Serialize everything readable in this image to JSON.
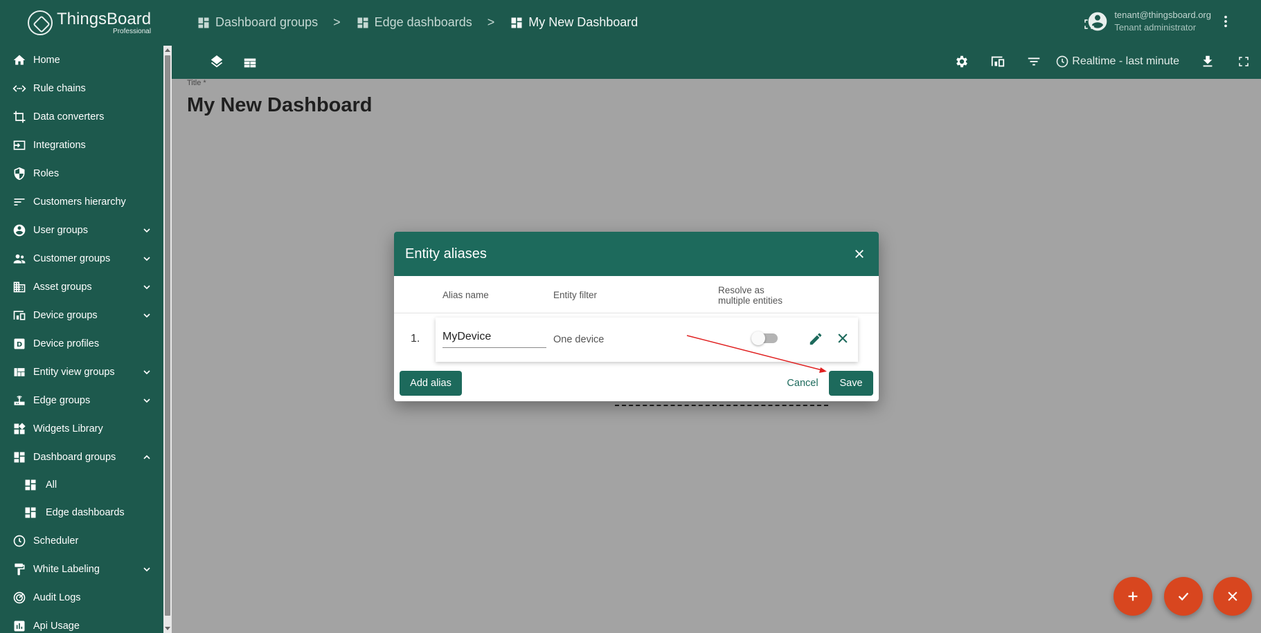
{
  "app": {
    "logo_name": "ThingsBoard",
    "logo_sub": "Professional"
  },
  "sidebar": {
    "items": [
      {
        "label": "Home",
        "icon": "home-icon"
      },
      {
        "label": "Rule chains",
        "icon": "rule-chains-icon"
      },
      {
        "label": "Data converters",
        "icon": "data-converters-icon"
      },
      {
        "label": "Integrations",
        "icon": "integrations-icon"
      },
      {
        "label": "Roles",
        "icon": "shield-icon"
      },
      {
        "label": "Customers hierarchy",
        "icon": "sort-icon"
      },
      {
        "label": "User groups",
        "icon": "account-circle-icon",
        "expandable": true
      },
      {
        "label": "Customer groups",
        "icon": "supervisor-icon",
        "expandable": true
      },
      {
        "label": "Asset groups",
        "icon": "domain-icon",
        "expandable": true
      },
      {
        "label": "Device groups",
        "icon": "devices-icon",
        "expandable": true
      },
      {
        "label": "Device profiles",
        "icon": "device-profile-icon"
      },
      {
        "label": "Entity view groups",
        "icon": "view-quilt-icon",
        "expandable": true
      },
      {
        "label": "Edge groups",
        "icon": "router-icon",
        "expandable": true
      },
      {
        "label": "Widgets Library",
        "icon": "widgets-icon"
      },
      {
        "label": "Dashboard groups",
        "icon": "dashboard-icon",
        "expanded": true
      },
      {
        "label": "All",
        "icon": "dashboard-icon",
        "sub": true
      },
      {
        "label": "Edge dashboards",
        "icon": "dashboard-icon",
        "sub": true
      },
      {
        "label": "Scheduler",
        "icon": "clock-icon"
      },
      {
        "label": "White Labeling",
        "icon": "format-paint-icon",
        "expandable": true
      },
      {
        "label": "Audit Logs",
        "icon": "track-changes-icon"
      },
      {
        "label": "Api Usage",
        "icon": "insert-chart-icon"
      }
    ]
  },
  "header": {
    "breadcrumbs": [
      "Dashboard groups",
      "Edge dashboards",
      "My New Dashboard"
    ],
    "separator": ">",
    "user_email": "tenant@thingsboard.org",
    "user_role": "Tenant administrator",
    "timewindow": "Realtime - last minute"
  },
  "content": {
    "title_label": "Title *",
    "title_value": "My New Dashboard"
  },
  "dialog": {
    "title": "Entity aliases",
    "columns": {
      "alias": "Alias name",
      "filter": "Entity filter",
      "resolve_line1": "Resolve as",
      "resolve_line2": "multiple entities"
    },
    "rows": [
      {
        "num": "1.",
        "alias": "MyDevice",
        "filter": "One device",
        "resolve_multiple": false
      }
    ],
    "add_label": "Add alias",
    "cancel_label": "Cancel",
    "save_label": "Save"
  },
  "colors": {
    "primary": "#1d594d",
    "dialog_header": "#1d6a5c",
    "fab": "#d8461f",
    "annotation_arrow": "#e02020"
  }
}
